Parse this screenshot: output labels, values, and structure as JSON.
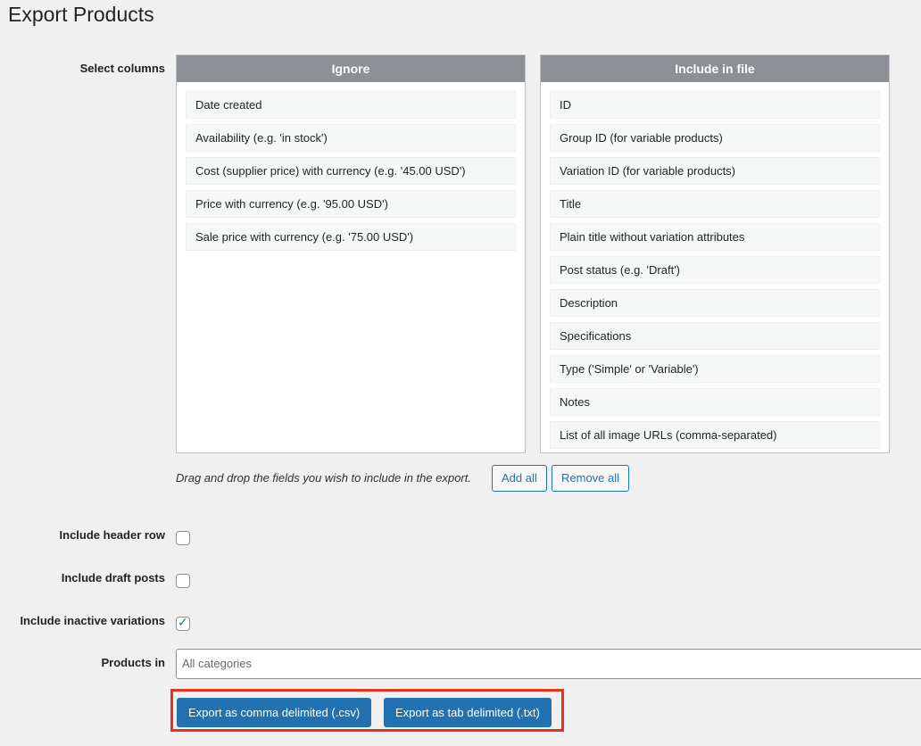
{
  "page": {
    "title": "Export Products"
  },
  "columns": {
    "label": "Select columns",
    "ignore": {
      "title": "Ignore",
      "items": [
        "Date created",
        "Availability (e.g. 'in stock')",
        "Cost (supplier price) with currency (e.g. '45.00 USD')",
        "Price with currency (e.g. '95.00 USD')",
        "Sale price with currency (e.g. '75.00 USD')"
      ]
    },
    "include": {
      "title": "Include in file",
      "items": [
        "ID",
        "Group ID (for variable products)",
        "Variation ID (for variable products)",
        "Title",
        "Plain title without variation attributes",
        "Post status (e.g. 'Draft')",
        "Description",
        "Specifications",
        "Type ('Simple' or 'Variable')",
        "Notes",
        "List of all image URLs (comma-separated)"
      ]
    },
    "helper": "Drag and drop the fields you wish to include in the export.",
    "add_all_label": "Add all",
    "remove_all_label": "Remove all"
  },
  "options": {
    "header_row": {
      "label": "Include header row",
      "checked": false
    },
    "draft_posts": {
      "label": "Include draft posts",
      "checked": false
    },
    "inactive_variations": {
      "label": "Include inactive variations",
      "checked": true
    }
  },
  "products_in": {
    "label": "Products in",
    "placeholder": "All categories"
  },
  "export": {
    "csv_label": "Export as comma delimited (.csv)",
    "txt_label": "Export as tab delimited (.txt)",
    "highlight_color": "#e8321f"
  }
}
